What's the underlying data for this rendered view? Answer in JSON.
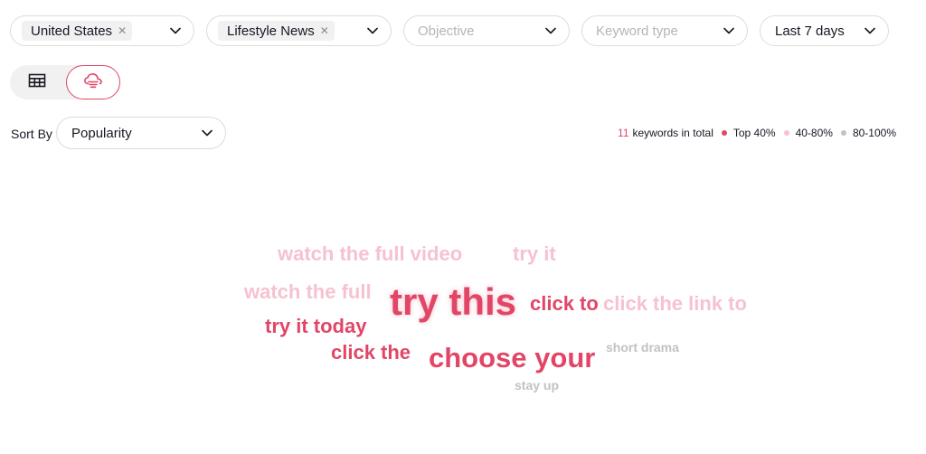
{
  "filters": {
    "country": {
      "chip": "United States"
    },
    "industry": {
      "chip": "Lifestyle News"
    },
    "objective": {
      "placeholder": "Objective"
    },
    "keyword_type": {
      "placeholder": "Keyword type"
    },
    "period": {
      "value": "Last 7 days"
    }
  },
  "sort": {
    "label": "Sort By",
    "value": "Popularity"
  },
  "legend": {
    "count": "11",
    "count_suffix": "keywords in total",
    "tiers": [
      {
        "label": "Top 40%",
        "color": "#e14667"
      },
      {
        "label": "40-80%",
        "color": "#f6c2d0"
      },
      {
        "label": "80-100%",
        "color": "#c2c2c4"
      }
    ]
  },
  "colors": {
    "accent": "#e14667",
    "light_pink": "#f6c2d0",
    "gray": "#c2c2c4"
  },
  "words": [
    {
      "text": "watch the full video",
      "tier": "40-80%"
    },
    {
      "text": "try it",
      "tier": "40-80%"
    },
    {
      "text": "watch the full",
      "tier": "40-80%"
    },
    {
      "text": "try this",
      "tier": "Top 40%"
    },
    {
      "text": "click to",
      "tier": "Top 40%"
    },
    {
      "text": "click the link to",
      "tier": "40-80%"
    },
    {
      "text": "try it today",
      "tier": "Top 40%"
    },
    {
      "text": "click the",
      "tier": "Top 40%"
    },
    {
      "text": "choose your",
      "tier": "Top 40%"
    },
    {
      "text": "short drama",
      "tier": "80-100%"
    },
    {
      "text": "stay up",
      "tier": "80-100%"
    }
  ]
}
